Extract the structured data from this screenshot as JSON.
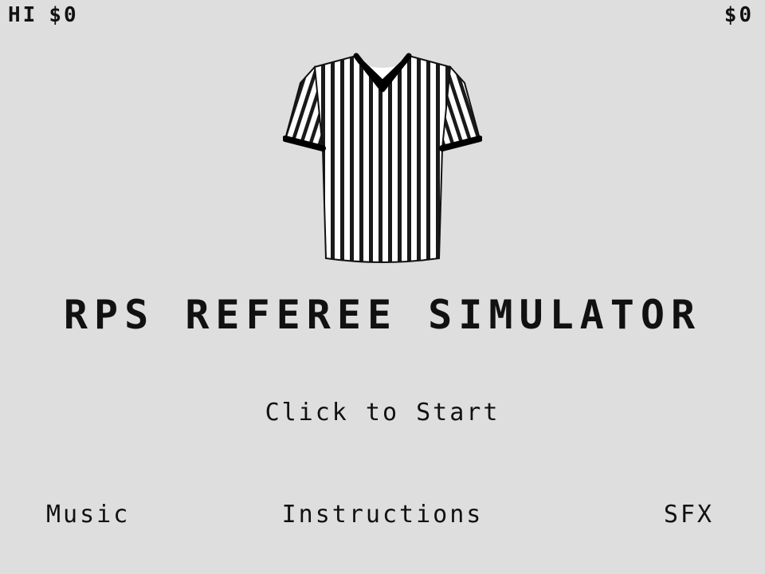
{
  "hud": {
    "hi_label": "HI",
    "hi_value": "$0",
    "money": "$0"
  },
  "title": "RPS REFEREE SIMULATOR",
  "start_prompt": "Click to Start",
  "menu": {
    "music": "Music",
    "instructions": "Instructions",
    "sfx": "SFX"
  },
  "icons": {
    "jersey": "referee-jersey-icon"
  },
  "colors": {
    "background": "#dedede",
    "text": "#111111",
    "stripe_dark": "#1a1a1a",
    "stripe_light": "#ffffff"
  }
}
